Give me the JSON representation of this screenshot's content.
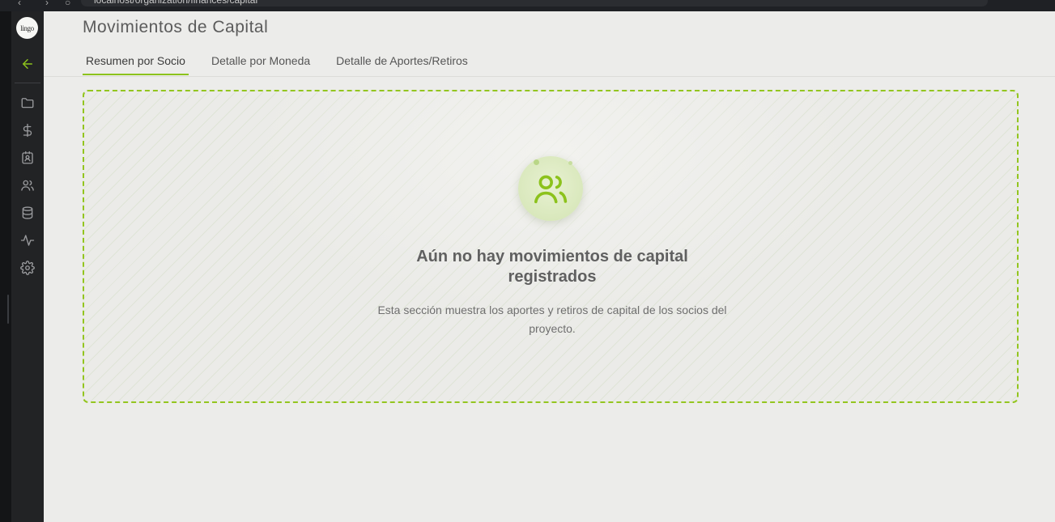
{
  "browser": {
    "url_text": "localhost/organization/finances/capital"
  },
  "sidebar": {
    "logo_text": "lingo",
    "back_icon": "arrow-left-icon",
    "items": [
      {
        "icon": "folder-icon"
      },
      {
        "icon": "dollar-icon"
      },
      {
        "icon": "contact-card-icon"
      },
      {
        "icon": "users-icon"
      },
      {
        "icon": "database-icon"
      },
      {
        "icon": "activity-icon"
      },
      {
        "icon": "gear-icon"
      }
    ]
  },
  "page": {
    "title": "Movimientos de Capital",
    "tabs": [
      {
        "label": "Resumen por Socio",
        "active": true
      },
      {
        "label": "Detalle por Moneda",
        "active": false
      },
      {
        "label": "Detalle de Aportes/Retiros",
        "active": false
      }
    ]
  },
  "empty_state": {
    "icon": "users-icon",
    "title": "Aún no hay movimientos de capital registrados",
    "description": "Esta sección muestra los aportes y retiros de capital de los socios del proyecto."
  },
  "colors": {
    "accent": "#8cc21c",
    "sidebar_bg": "#222325",
    "page_bg": "#ececea"
  }
}
